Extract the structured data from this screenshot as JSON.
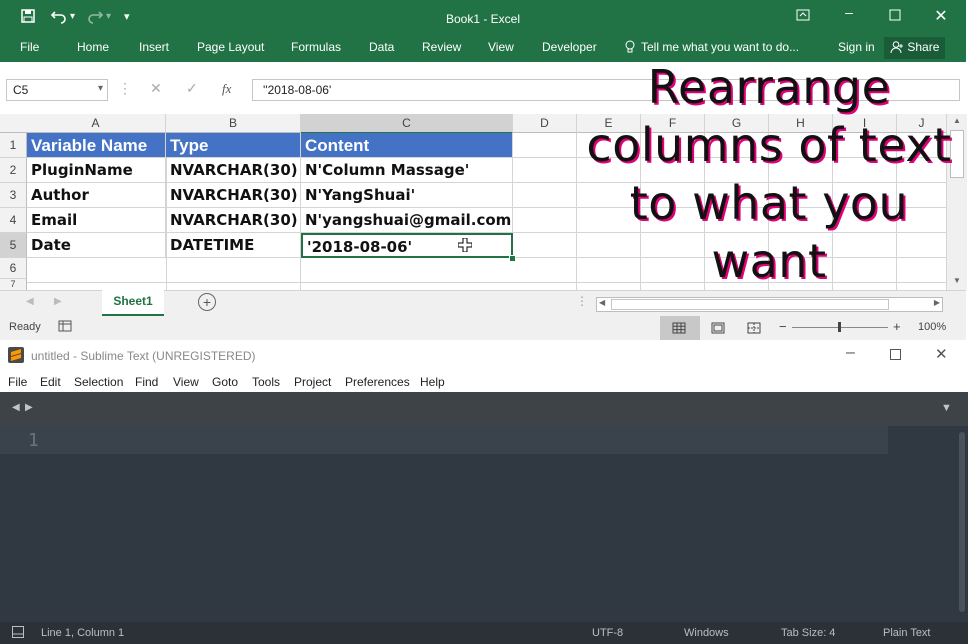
{
  "excel": {
    "title": "Book1 - Excel",
    "qat": {
      "save_icon": "save-icon",
      "undo_icon": "undo-icon",
      "redo_icon": "redo-icon",
      "customize": "▾"
    },
    "ribbon_tabs": [
      "File",
      "Home",
      "Insert",
      "Page Layout",
      "Formulas",
      "Data",
      "Review",
      "View",
      "Developer"
    ],
    "tell_me": "Tell me what you want to do...",
    "sign_in": "Sign in",
    "share": "Share",
    "name_box": "C5",
    "fx": "fx",
    "formula_value": "''2018-08-06'",
    "columns": [
      "A",
      "B",
      "C",
      "D",
      "E",
      "F",
      "G",
      "H",
      "I",
      "J"
    ],
    "rows": [
      "1",
      "2",
      "3",
      "4",
      "5",
      "6",
      "7"
    ],
    "table": {
      "headers": [
        "Variable Name",
        "Type",
        "Content"
      ],
      "data": [
        [
          "PluginName",
          "NVARCHAR(30)",
          "N'Column Massage'"
        ],
        [
          "Author",
          "NVARCHAR(30)",
          "N'YangShuai'"
        ],
        [
          "Email",
          "NVARCHAR(30)",
          "N'yangshuai@gmail.com'"
        ],
        [
          "Date",
          "DATETIME",
          "'2018-08-06'"
        ]
      ]
    },
    "sheet_tab": "Sheet1",
    "status": "Ready",
    "zoom": "100%",
    "accent_color": "#217346",
    "header_fill_color": "#4472c4"
  },
  "overlay": {
    "lines": [
      "Rearrange",
      "columns of text",
      "to what you",
      "want"
    ]
  },
  "sublime": {
    "title": "untitled - Sublime Text (UNREGISTERED)",
    "menu": [
      "File",
      "Edit",
      "Selection",
      "Find",
      "View",
      "Goto",
      "Tools",
      "Project",
      "Preferences",
      "Help"
    ],
    "line_number": "1",
    "status": {
      "position": "Line 1, Column 1",
      "encoding": "UTF-8",
      "line_endings": "Windows",
      "tab_size": "Tab Size: 4",
      "syntax": "Plain Text"
    }
  }
}
